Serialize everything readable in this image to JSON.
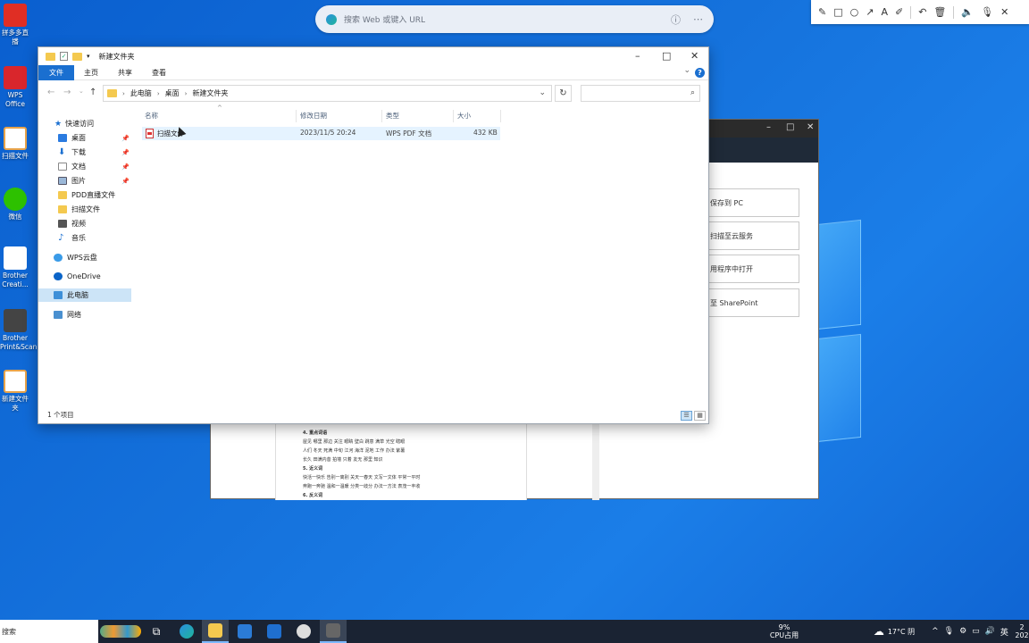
{
  "browser": {
    "search_placeholder": "搜索 Web 或键入 URL"
  },
  "desktop": {
    "icons": [
      {
        "label": "拼多多直播"
      },
      {
        "label": "WPS Office"
      },
      {
        "label": "扫描文件"
      },
      {
        "label": "微信"
      },
      {
        "label": "Brother Creati..."
      },
      {
        "label": "Brother Print&Scan"
      },
      {
        "label": "新建文件夹"
      }
    ]
  },
  "scan_window": {
    "buttons": [
      "保存到 PC",
      "扫描至云服务",
      "用程序中打开",
      "至 SharePoint"
    ],
    "preview": {
      "section1_title": "4. 重点词语",
      "line1": "屋见  哪里  那边  关注  眼睛  壁白  跳意  满草  光空  瞎眼",
      "line2": "人们  冬天  死满  中旬  江河  海洋  泥地  工作  办法  紫薯",
      "line3": "长久  田满内昔  拍墙  只着  友无  那里  知识",
      "section2_title": "5. 近义词",
      "line4": "快活一快乐  告别一离别  关天一春天  文写一文体  平常一平时",
      "line5": "奔跑一奔驰  温和一温暖  分类一歧分  办法一方法  表茂一丰收",
      "section3_title": "6. 反义词"
    }
  },
  "explorer": {
    "title": "新建文件夹",
    "ribbon_tabs": [
      "文件",
      "主页",
      "共享",
      "查看"
    ],
    "breadcrumb": [
      "此电脑",
      "桌面",
      "新建文件夹"
    ],
    "search_placeholder": "",
    "nav": {
      "quick_access": "快速访问",
      "items": [
        {
          "label": "桌面",
          "pinned": true
        },
        {
          "label": "下载",
          "pinned": true
        },
        {
          "label": "文档",
          "pinned": true
        },
        {
          "label": "图片",
          "pinned": true
        },
        {
          "label": "PDD直播文件",
          "pinned": false
        },
        {
          "label": "扫描文件",
          "pinned": false
        },
        {
          "label": "视频",
          "pinned": false
        },
        {
          "label": "音乐",
          "pinned": false
        }
      ],
      "wps_cloud": "WPS云盘",
      "onedrive": "OneDrive",
      "this_pc": "此电脑",
      "network": "网络"
    },
    "columns": [
      "名称",
      "修改日期",
      "类型",
      "大小"
    ],
    "files": [
      {
        "name": "扫描文件",
        "modified": "2023/11/5 20:24",
        "type": "WPS PDF 文档",
        "size": "432 KB"
      }
    ],
    "status": "1 个项目"
  },
  "taskbar": {
    "search_label": "搜索",
    "cpu_percent": "9%",
    "cpu_label": "CPU占用",
    "weather": "17°C 阴",
    "ime": "英",
    "clock_fragment": "2",
    "date_fragment": "202"
  },
  "colors": {
    "accent": "#1a6fd0",
    "selection": "#cce4f7",
    "desktop": "#1572dc",
    "taskbar": "#1a2333"
  }
}
